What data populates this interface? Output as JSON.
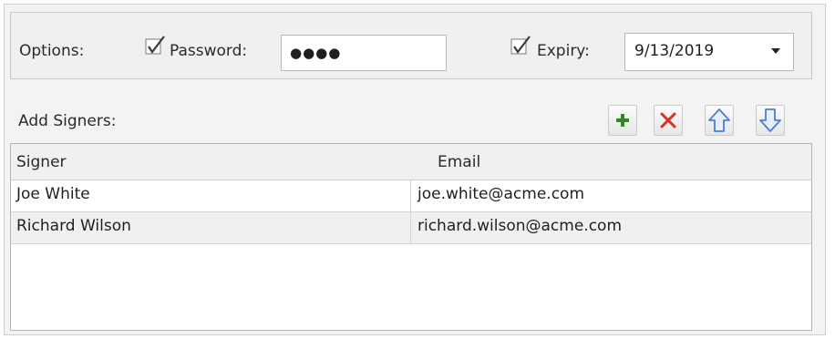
{
  "options": {
    "label": "Options:",
    "password": {
      "label": "Password:",
      "checked": true,
      "value": "●●●●"
    },
    "expiry": {
      "label": "Expiry:",
      "checked": true,
      "value": "9/13/2019"
    }
  },
  "signers": {
    "label": "Add Signers:",
    "toolbar": {
      "add_icon": "plus-icon",
      "remove_icon": "delete-x-icon",
      "up_icon": "arrow-up-icon",
      "down_icon": "arrow-down-icon"
    },
    "columns": [
      "Signer",
      "Email"
    ],
    "rows": [
      {
        "signer": "Joe White",
        "email": "joe.white@acme.com"
      },
      {
        "signer": "Richard Wilson",
        "email": "richard.wilson@acme.com"
      }
    ]
  },
  "colors": {
    "add_green": "#2e8b1f",
    "remove_red": "#d9331f",
    "arrow_blue": "#4a7fd4",
    "panel_bg": "#f0f0f0"
  }
}
